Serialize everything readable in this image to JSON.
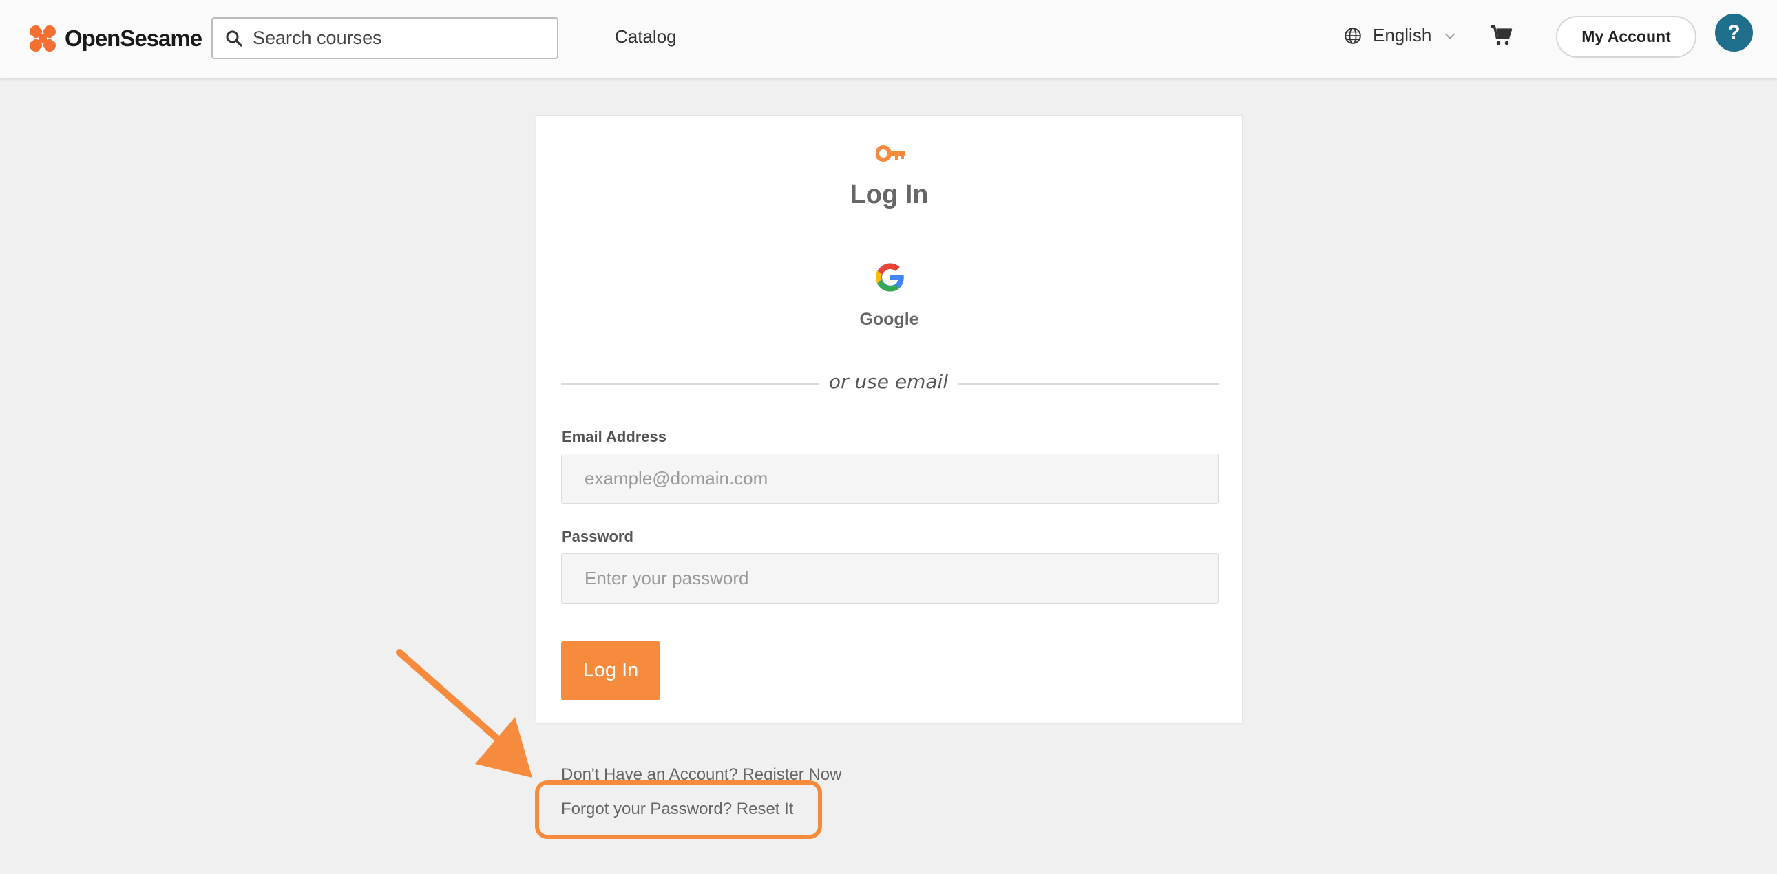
{
  "header": {
    "brand": "OpenSesame",
    "search_placeholder": "Search courses",
    "catalog_label": "Catalog",
    "language_label": "English",
    "account_label": "My Account",
    "help_label": "?"
  },
  "login": {
    "title": "Log In",
    "google_label": "Google",
    "divider_text": "or use email",
    "email_label": "Email Address",
    "email_placeholder": "example@domain.com",
    "password_label": "Password",
    "password_placeholder": "Enter your password",
    "submit_label": "Log In"
  },
  "links": {
    "register": "Don't Have an Account? Register Now",
    "reset": "Forgot your Password? Reset It"
  },
  "colors": {
    "accent": "#f68b3d",
    "help_bg": "#1f6e8c",
    "annotation": "#f68b3d"
  },
  "icons": [
    "opensesame-logo-icon",
    "search-icon",
    "globe-icon",
    "chevron-down-icon",
    "cart-icon",
    "key-icon",
    "google-icon",
    "annotation-arrow-icon"
  ]
}
